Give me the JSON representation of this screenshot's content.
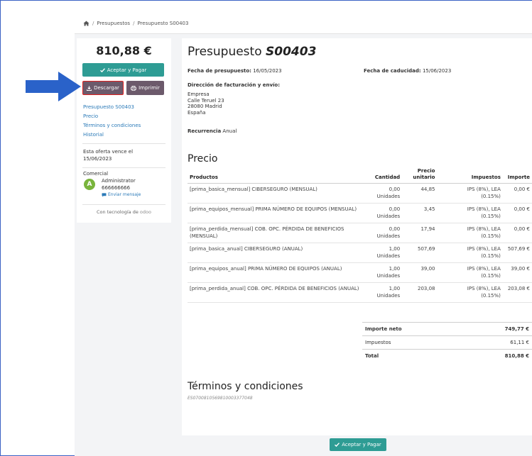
{
  "breadcrumb": {
    "items": [
      "Presupuestos",
      "Presupuesto S00403"
    ]
  },
  "sidebar": {
    "amount": "810,88 €",
    "accept_label": "Aceptar y Pagar",
    "download_label": "Descargar",
    "print_label": "Imprimir",
    "links": [
      "Presupuesto S00403",
      "Precio",
      "Términos y condiciones",
      "Historial"
    ],
    "expire_line1": "Esta oferta vence el",
    "expire_line2": "15/06/2023",
    "comercial_label": "Comercial",
    "avatar_letter": "A",
    "salesperson_name": "Administrator",
    "salesperson_phone": "666666666",
    "send_message": "Enviar mensaje",
    "powered_by": "Con tecnología de",
    "powered_brand": "odoo"
  },
  "doc": {
    "title_prefix": "Presupuesto",
    "title_number": "S00403",
    "date_label": "Fecha de presupuesto:",
    "date_value": "16/05/2023",
    "expiry_label": "Fecha de caducidad:",
    "expiry_value": "15/06/2023",
    "address_label": "Dirección de facturación y envío:",
    "address_lines": [
      "Empresa",
      "Calle Teruel 23",
      "28080 Madrid",
      "España"
    ],
    "recurrence_label": "Recurrencia",
    "recurrence_value": "Anual"
  },
  "pricing": {
    "section_title": "Precio",
    "headers": {
      "product": "Productos",
      "qty": "Cantidad",
      "price_line1": "Precio",
      "price_line2": "unitario",
      "taxes": "Impuestos",
      "amount": "Importe"
    },
    "rows": [
      {
        "product": "[prima_basica_mensual] CIBERSEGURO (MENSUAL)",
        "qty": "0,00",
        "unit": "Unidades",
        "price": "44,85",
        "tax1": "IPS (8%), LEA",
        "tax2": "(0.15%)",
        "amount": "0,00 €"
      },
      {
        "product": "[prima_equipos_mensual] PRIMA NÚMERO DE EQUIPOS (MENSUAL)",
        "qty": "0,00",
        "unit": "Unidades",
        "price": "3,45",
        "tax1": "IPS (8%), LEA",
        "tax2": "(0.15%)",
        "amount": "0,00 €"
      },
      {
        "product": "[prima_perdida_mensual] COB. OPC. PÉRDIDA DE BENEFICIOS (MENSUAL)",
        "qty": "0,00",
        "unit": "Unidades",
        "price": "17,94",
        "tax1": "IPS (8%), LEA",
        "tax2": "(0.15%)",
        "amount": "0,00 €"
      },
      {
        "product": "[prima_basica_anual] CIBERSEGURO (ANUAL)",
        "qty": "1,00",
        "unit": "Unidades",
        "price": "507,69",
        "tax1": "IPS (8%), LEA",
        "tax2": "(0.15%)",
        "amount": "507,69 €"
      },
      {
        "product": "[prima_equipos_anual] PRIMA NÚMERO DE EQUIPOS (ANUAL)",
        "qty": "1,00",
        "unit": "Unidades",
        "price": "39,00",
        "tax1": "IPS (8%), LEA",
        "tax2": "(0.15%)",
        "amount": "39,00 €"
      },
      {
        "product": "[prima_perdida_anual] COB. OPC. PÉRDIDA DE BENEFICIOS (ANUAL)",
        "qty": "1,00",
        "unit": "Unidades",
        "price": "203,08",
        "tax1": "IPS (8%), LEA",
        "tax2": "(0.15%)",
        "amount": "203,08 €"
      }
    ],
    "totals": {
      "net_label": "Importe neto",
      "net_value": "749,77 €",
      "tax_label": "Impuestos",
      "tax_value": "61,11 €",
      "total_label": "Total",
      "total_value": "810,88 €"
    }
  },
  "terms": {
    "section_title": "Términos y condiciones",
    "code": "ES0700810569810003377048"
  },
  "bottom": {
    "accept_label": "Aceptar y Pagar"
  },
  "colors": {
    "accent": "#2e9c94",
    "secondary_button": "#6c5a6b",
    "link": "#2b7ab8",
    "arrow": "#2a62c9",
    "highlight_border": "#e02020",
    "avatar": "#79b43c"
  }
}
